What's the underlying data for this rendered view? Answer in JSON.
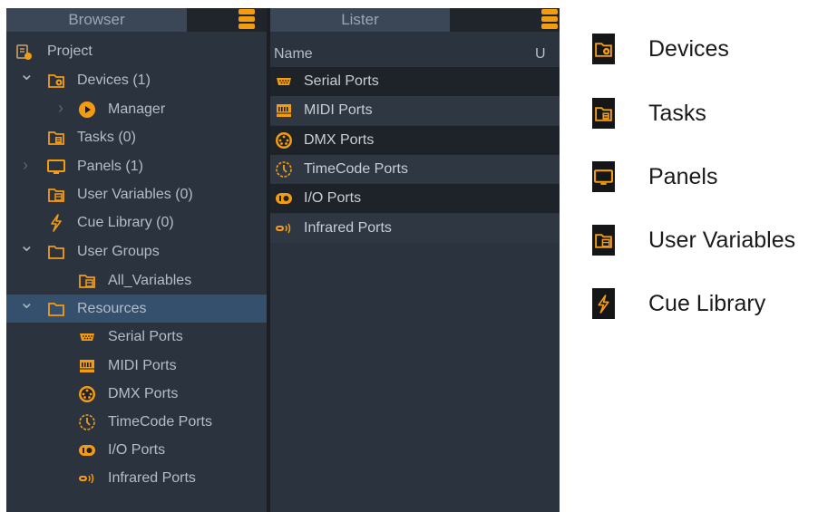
{
  "colors": {
    "accent": "#f39c12",
    "panel_bg": "#2b333e",
    "selected_row": "#34506d",
    "header_bg": "#3b4757",
    "text": "#b5bdc8"
  },
  "browser": {
    "title": "Browser",
    "menu_icon": "hamburger-menu-icon",
    "tree": [
      {
        "label": "Project",
        "icon": "project-icon",
        "chevron": ""
      },
      {
        "label": "Devices (1)",
        "icon": "devices-folder-icon",
        "chevron": "expanded"
      },
      {
        "label": "Manager",
        "icon": "play-circle-icon",
        "chevron": "collapsed"
      },
      {
        "label": "Tasks (0)",
        "icon": "tasks-folder-icon",
        "chevron": ""
      },
      {
        "label": "Panels (1)",
        "icon": "monitor-icon",
        "chevron": "collapsed"
      },
      {
        "label": "User Variables (0)",
        "icon": "variables-folder-icon",
        "chevron": ""
      },
      {
        "label": "Cue Library (0)",
        "icon": "lightning-icon",
        "chevron": ""
      },
      {
        "label": "User Groups",
        "icon": "folder-icon",
        "chevron": "expanded"
      },
      {
        "label": "All_Variables",
        "icon": "variables-folder-icon",
        "chevron": ""
      },
      {
        "label": "Resources",
        "icon": "folder-icon",
        "chevron": "expanded",
        "selected": true
      },
      {
        "label": "Serial Ports",
        "icon": "serial-port-icon",
        "chevron": ""
      },
      {
        "label": "MIDI Ports",
        "icon": "midi-port-icon",
        "chevron": ""
      },
      {
        "label": "DMX Ports",
        "icon": "dmx-port-icon",
        "chevron": ""
      },
      {
        "label": "TimeCode Ports",
        "icon": "timecode-icon",
        "chevron": ""
      },
      {
        "label": "I/O Ports",
        "icon": "io-port-icon",
        "chevron": ""
      },
      {
        "label": "Infrared Ports",
        "icon": "infrared-icon",
        "chevron": ""
      }
    ]
  },
  "lister": {
    "title": "Lister",
    "menu_icon": "hamburger-menu-icon",
    "columns": [
      "Name",
      "U"
    ],
    "rows": [
      {
        "label": "Serial Ports",
        "icon": "serial-port-icon"
      },
      {
        "label": "MIDI Ports",
        "icon": "midi-port-icon"
      },
      {
        "label": "DMX Ports",
        "icon": "dmx-port-icon"
      },
      {
        "label": "TimeCode Ports",
        "icon": "timecode-icon"
      },
      {
        "label": "I/O Ports",
        "icon": "io-port-icon"
      },
      {
        "label": "Infrared Ports",
        "icon": "infrared-icon"
      }
    ]
  },
  "legend": [
    {
      "label": "Devices",
      "icon": "devices-folder-icon"
    },
    {
      "label": "Tasks",
      "icon": "tasks-folder-icon"
    },
    {
      "label": "Panels",
      "icon": "monitor-icon"
    },
    {
      "label": "User Variables",
      "icon": "variables-folder-icon"
    },
    {
      "label": "Cue Library",
      "icon": "lightning-icon"
    }
  ]
}
